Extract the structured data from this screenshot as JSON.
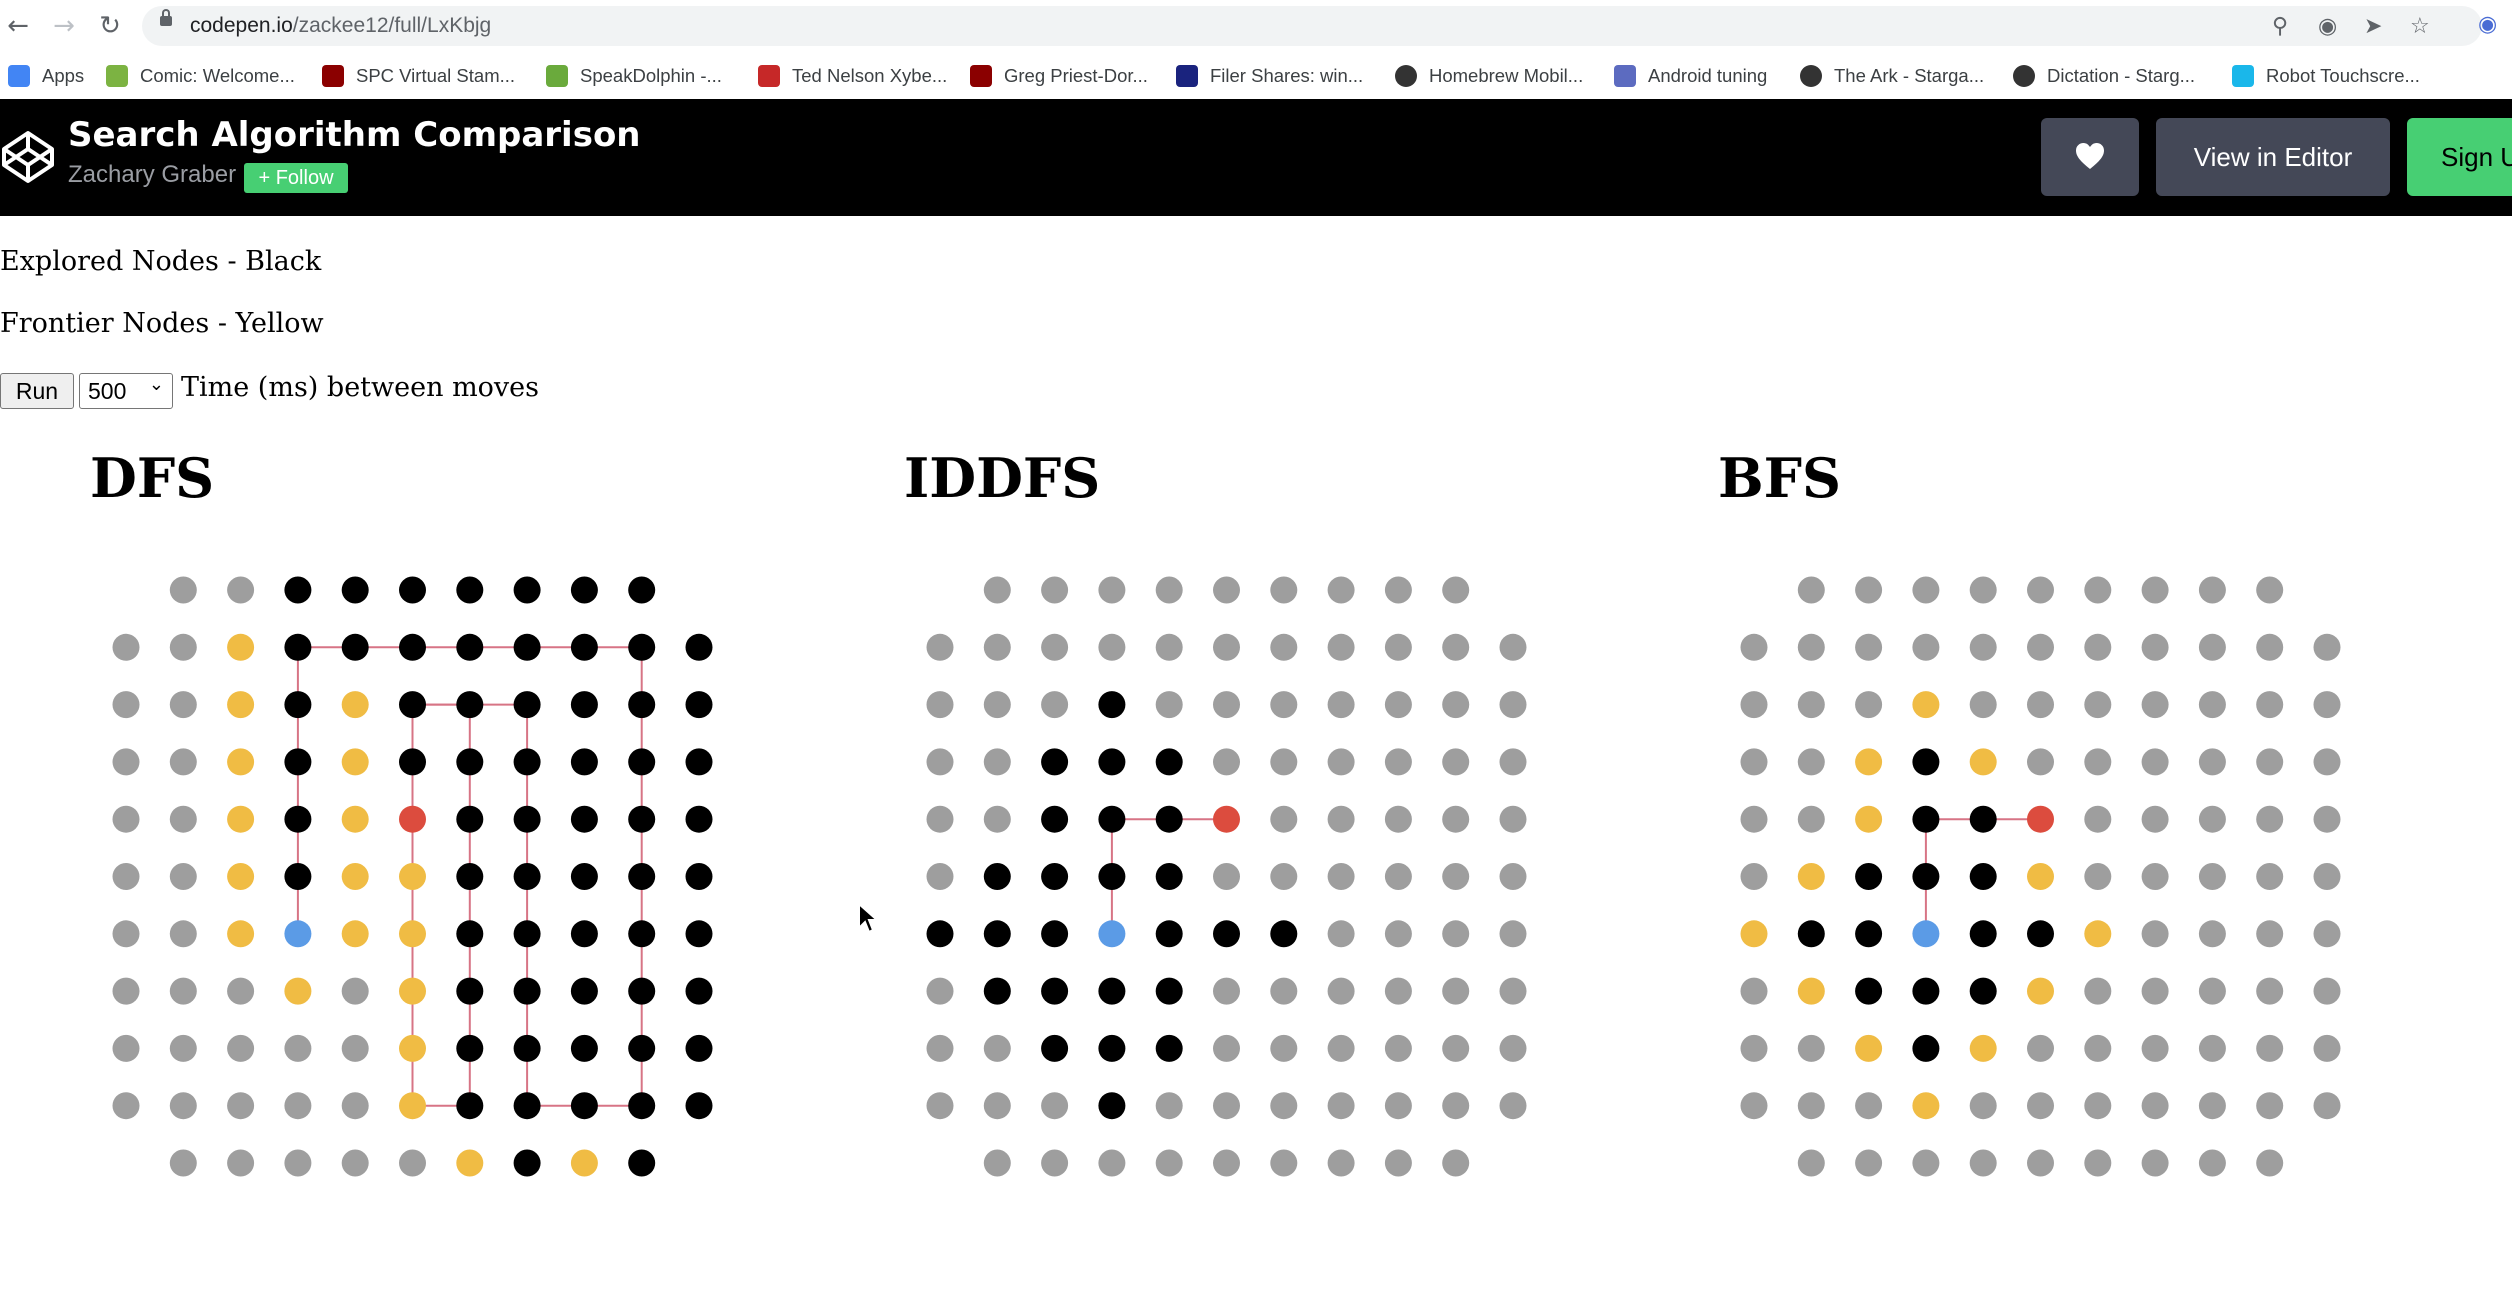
{
  "browser": {
    "url_host": "codepen.io",
    "url_path": "/zackee12/full/LxKbjg",
    "bookmarks": [
      {
        "label": "Apps",
        "icon": "apps-grid-icon",
        "color": "#4285f4"
      },
      {
        "label": "Comic: Welcome...",
        "icon": "comic-favicon",
        "color": "#7cb342"
      },
      {
        "label": "SPC Virtual Stam...",
        "icon": "spc-favicon",
        "color": "#8b0000"
      },
      {
        "label": "SpeakDolphin -...",
        "icon": "speakdolphin-favicon",
        "color": "#6aaa3c"
      },
      {
        "label": "Ted Nelson Xybe...",
        "icon": "xybe-favicon",
        "color": "#c62828"
      },
      {
        "label": "Greg Priest-Dor...",
        "icon": "greg-favicon",
        "color": "#8b0000"
      },
      {
        "label": "Filer Shares: win...",
        "icon": "filer-favicon",
        "color": "#1a237e"
      },
      {
        "label": "Homebrew Mobil...",
        "icon": "globe-icon",
        "color": "#333333"
      },
      {
        "label": "Android tuning",
        "icon": "android-favicon",
        "color": "#5c6bc0"
      },
      {
        "label": "The Ark - Starga...",
        "icon": "globe-icon",
        "color": "#333333"
      },
      {
        "label": "Dictation - Starg...",
        "icon": "globe-icon",
        "color": "#333333"
      },
      {
        "label": "Robot Touchscre...",
        "icon": "vimeo-favicon",
        "color": "#1ab7ea"
      }
    ]
  },
  "header": {
    "title": "Search Algorithm Comparison",
    "author": "Zachary Graber",
    "follow_label": "Follow",
    "editor_label": "View in Editor",
    "signup_label": "Sign Up"
  },
  "legend": {
    "explored": "Explored Nodes - Black",
    "frontier": "Frontier Nodes - Yellow"
  },
  "controls": {
    "run_label": "Run",
    "time_value": "500",
    "time_label": "Time (ms) between moves"
  },
  "colors": {
    "unvisited": "#9e9e9e",
    "explored": "#000000",
    "frontier": "#f0bc44",
    "start": "#5b9be6",
    "goal": "#dc4c3e",
    "path": "#d77485"
  },
  "panels": [
    {
      "title": "DFS",
      "grid": [
        "_UUEEEEEEE_",
        "UUFEEEEEEEE",
        "UUFEFEEEEEE",
        "UUFEFEEEEEE",
        "UUFEFGEEEEE",
        "UUFEFFEEEEE",
        "UUFSFFEEEEE",
        "UUUFUFEEEEE",
        "UUUUUFEEEEE",
        "UUUUUFEEEEE",
        "_UUUUUFEFE_"
      ],
      "path": [
        [
          3,
          6
        ],
        [
          3,
          5
        ],
        [
          3,
          4
        ],
        [
          3,
          3
        ],
        [
          3,
          2
        ],
        [
          3,
          1
        ],
        [
          4,
          1
        ],
        [
          5,
          1
        ],
        [
          6,
          1
        ],
        [
          7,
          1
        ],
        [
          8,
          1
        ],
        [
          9,
          1
        ],
        [
          9,
          2
        ],
        [
          9,
          3
        ],
        [
          9,
          4
        ],
        [
          9,
          5
        ],
        [
          9,
          6
        ],
        [
          9,
          7
        ],
        [
          9,
          8
        ],
        [
          9,
          9
        ],
        [
          8,
          9
        ],
        [
          7,
          9
        ],
        [
          7,
          8
        ],
        [
          7,
          7
        ],
        [
          7,
          6
        ],
        [
          7,
          5
        ],
        [
          7,
          4
        ],
        [
          7,
          3
        ],
        [
          7,
          2
        ],
        [
          6,
          2
        ],
        [
          5,
          2
        ],
        [
          5,
          3
        ],
        [
          5,
          4
        ],
        [
          5,
          5
        ],
        [
          5,
          6
        ],
        [
          5,
          7
        ],
        [
          5,
          8
        ],
        [
          5,
          9
        ],
        [
          6,
          9
        ],
        [
          6,
          8
        ],
        [
          6,
          7
        ],
        [
          6,
          6
        ],
        [
          6,
          5
        ],
        [
          6,
          4
        ],
        [
          6,
          3
        ],
        [
          6,
          2
        ],
        [
          5,
          2
        ],
        [
          5,
          3
        ],
        [
          5,
          4
        ]
      ]
    },
    {
      "title": "IDDFS",
      "grid": [
        "_UUUUUUUUU_",
        "UUUUUUUUUUU",
        "UUUEUUUUUUU",
        "UUEEEUUUUUU",
        "UUEEEGUUUUU",
        "UEEEEUUUUUU",
        "EEESEEEUUUU",
        "UEEEEUUUUUU",
        "UUEEEUUUUUU",
        "UUUEUUUUUUU",
        "_UUUUUUUUU_"
      ],
      "path": [
        [
          3,
          6
        ],
        [
          3,
          5
        ],
        [
          3,
          4
        ],
        [
          4,
          4
        ],
        [
          5,
          4
        ]
      ]
    },
    {
      "title": "BFS",
      "grid": [
        "_UUUUUUUUU_",
        "UUUUUUUUUUU",
        "UUUFUUUUUUU",
        "UUFEFUUUUUU",
        "UUFEEGUUUUU",
        "UFEEEFUUUUU",
        "FEESEEFUUUU",
        "UFEEEFUUUUU",
        "UUFEFUUUUUU",
        "UUUFUUUUUUU",
        "_UUUUUUUUU_"
      ],
      "path": [
        [
          3,
          6
        ],
        [
          3,
          5
        ],
        [
          3,
          4
        ],
        [
          4,
          4
        ],
        [
          5,
          4
        ]
      ]
    }
  ]
}
